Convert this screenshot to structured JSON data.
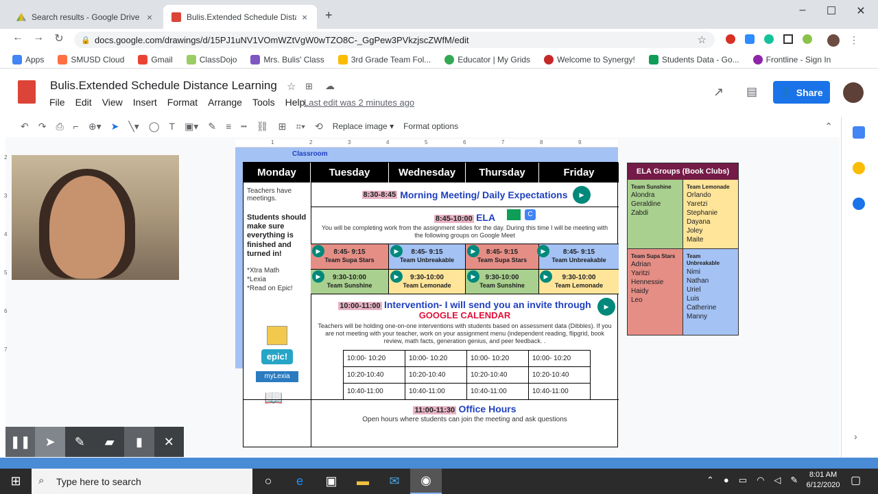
{
  "browser": {
    "tabs": [
      {
        "title": "Search results - Google Drive"
      },
      {
        "title": "Bulis.Extended Schedule Distance"
      }
    ],
    "url": "docs.google.com/drawings/d/15PJ1uNV1VOmWZtVgW0wTZO8C-_GgPew3PVkzjscZWfM/edit",
    "bookmarks": [
      "Apps",
      "SMUSD Cloud",
      "Gmail",
      "ClassDojo",
      "Mrs. Bulis' Class",
      "3rd Grade Team Fol...",
      "Educator | My Grids",
      "Welcome to Synergy!",
      "Students Data - Go...",
      "Frontline - Sign In"
    ]
  },
  "doc": {
    "title": "Bulis.Extended Schedule Distance Learning",
    "menus": [
      "File",
      "Edit",
      "View",
      "Insert",
      "Format",
      "Arrange",
      "Tools",
      "Help"
    ],
    "last_edit": "Last edit was 2 minutes ago",
    "share": "Share"
  },
  "toolbar": {
    "replace_image": "Replace image",
    "format_options": "Format options"
  },
  "ruler": [
    "1",
    "2",
    "3",
    "4",
    "5",
    "6",
    "7",
    "8",
    "9"
  ],
  "vruler": [
    "2",
    "3",
    "4",
    "5",
    "6",
    "7"
  ],
  "schedule": {
    "top_strip": "Classroom",
    "days": [
      "Monday",
      "Tuesday",
      "Wednesday",
      "Thursday",
      "Friday"
    ],
    "monday_note1": "Teachers have meetings.",
    "monday_note2": "Students should make sure everything is finished and turned in!",
    "monday_links": [
      "*Xtra Math",
      "*Lexia",
      "*Read on Epic!"
    ],
    "logos": {
      "epic": "epic!",
      "mylexia": "myLexia"
    },
    "morning": {
      "time": "8:30-8:45",
      "title": "Morning Meeting/ Daily Expectations"
    },
    "ela": {
      "time": "8:45-10:00",
      "title": "ELA",
      "desc": "You will be completing work from the assignment slides for the day. During this time I will be meeting with the following groups on Google Meet"
    },
    "groups_row1": [
      {
        "time": "8:45- 9:15",
        "team": "Team Supa Stars",
        "color": "#e58e86"
      },
      {
        "time": "8:45- 9:15",
        "team": "Team Unbreakable",
        "color": "#a4c2f4"
      },
      {
        "time": "8:45- 9:15",
        "team": "Team Supa Stars",
        "color": "#e58e86"
      },
      {
        "time": "8:45- 9:15",
        "team": "Team Unbreakable",
        "color": "#a4c2f4"
      }
    ],
    "groups_row2": [
      {
        "time": "9:30-10:00",
        "team": "Team Sunshine",
        "color": "#a9d08e"
      },
      {
        "time": "9:30-10:00",
        "team": "Team Lemonade",
        "color": "#ffe599"
      },
      {
        "time": "9:30-10:00",
        "team": "Team Sunshine",
        "color": "#a9d08e"
      },
      {
        "time": "9:30-10:00",
        "team": "Team Lemonade",
        "color": "#ffe599"
      }
    ],
    "intervention": {
      "time": "10:00-11:00",
      "title": "Intervention- I will send you an invite through",
      "subtitle": "GOOGLE CALENDAR",
      "desc": "Teachers will be holding one-on-one interventions with students based on assessment data (Dibbles). If you are not meeting with your teacher, work on your assignment menu (independent reading, flipgrid, book review, math facts, generation genius, and peer feedback. ."
    },
    "slots": [
      [
        "10:00- 10:20",
        "10:00- 10:20",
        "10:00- 10:20",
        "10:00- 10:20"
      ],
      [
        "10:20-10:40",
        "10:20-10:40",
        "10:20-10:40",
        "10:20-10:40"
      ],
      [
        "10:40-11:00",
        "10:40-11:00",
        "10:40-11:00",
        "10:40-11:00"
      ]
    ],
    "office": {
      "time": "11:00-11:30",
      "title": "Office Hours",
      "desc": "Open hours where students can join the meeting and ask questions"
    }
  },
  "ela_groups": {
    "title": "ELA Groups (Book Clubs)",
    "groups": [
      {
        "name": "Team Sunshine",
        "members": [
          "Alondra",
          "Geraldine",
          "Zabdi"
        ],
        "color": "#a9d08e"
      },
      {
        "name": "Team Lemonade",
        "members": [
          "Orlando",
          "Yaretzi",
          "Stephanie",
          "Dayana",
          "Joley",
          "Maite"
        ],
        "color": "#ffe599"
      },
      {
        "name": "Team Supa Stars",
        "members": [
          "Adrian",
          "Yaritzi",
          "Hennessie",
          "Haidy",
          "Leo"
        ],
        "color": "#e58e86"
      },
      {
        "name": "Team Unbreakable",
        "members": [
          "Nimi",
          "Nathan",
          "Uriel",
          "Luis",
          "Catherine",
          "Manny"
        ],
        "color": "#a4c2f4"
      }
    ]
  },
  "taskbar": {
    "search_placeholder": "Type here to search",
    "time": "8:01 AM",
    "date": "6/12/2020"
  }
}
